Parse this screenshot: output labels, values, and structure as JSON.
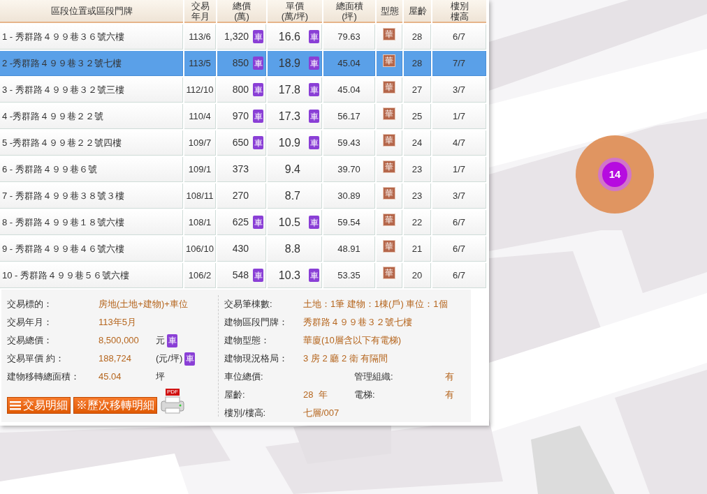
{
  "table": {
    "columns": [
      [
        "區段位置或區段門牌"
      ],
      [
        "交易",
        "年月"
      ],
      [
        "總價",
        "(萬)"
      ],
      [
        "單價",
        "(萬/坪)"
      ],
      [
        "總面積",
        "(坪)"
      ],
      [
        "型態"
      ],
      [
        "屋齡"
      ],
      [
        "樓別",
        "樓高"
      ]
    ],
    "rows": [
      {
        "address": "1 - 秀群路４９９巷３６號六樓",
        "date": "113/6",
        "total": "1,320",
        "total_badge": "車",
        "unit": "16.6",
        "unit_badge": "車",
        "area": "79.63",
        "type": "華",
        "age": "28",
        "floor": "6/7",
        "selected": false
      },
      {
        "address": "2 -秀群路４９９巷３２號七樓",
        "date": "113/5",
        "total": "850",
        "total_badge": "車",
        "unit": "18.9",
        "unit_badge": "車",
        "area": "45.04",
        "type": "華",
        "age": "28",
        "floor": "7/7",
        "selected": true
      },
      {
        "address": "3 - 秀群路４９９巷３２號三樓",
        "date": "112/10",
        "total": "800",
        "total_badge": "車",
        "unit": "17.8",
        "unit_badge": "車",
        "area": "45.04",
        "type": "華",
        "age": "27",
        "floor": "3/7",
        "selected": false
      },
      {
        "address": "4 -秀群路４９９巷２２號",
        "date": "110/4",
        "total": "970",
        "total_badge": "車",
        "unit": "17.3",
        "unit_badge": "車",
        "area": "56.17",
        "type": "華",
        "age": "25",
        "floor": "1/7",
        "selected": false
      },
      {
        "address": "5 -秀群路４９９巷２２號四樓",
        "date": "109/7",
        "total": "650",
        "total_badge": "車",
        "unit": "10.9",
        "unit_badge": "車",
        "area": "59.43",
        "type": "華",
        "age": "24",
        "floor": "4/7",
        "selected": false
      },
      {
        "address": "6 - 秀群路４９９巷６號",
        "date": "109/1",
        "total": "373",
        "unit": "9.4",
        "area": "39.70",
        "type": "華",
        "age": "23",
        "floor": "1/7",
        "selected": false
      },
      {
        "address": "7 - 秀群路４９９巷３８號３樓",
        "date": "108/11",
        "total": "270",
        "unit": "8.7",
        "area": "30.89",
        "type": "華",
        "age": "23",
        "floor": "3/7",
        "selected": false
      },
      {
        "address": "8 - 秀群路４９９巷１８號六樓",
        "date": "108/1",
        "total": "625",
        "total_badge": "車",
        "unit": "10.5",
        "unit_badge": "車",
        "area": "59.54",
        "type": "華",
        "age": "22",
        "floor": "6/7",
        "selected": false
      },
      {
        "address": "9 - 秀群路４９９巷４６號六樓",
        "date": "106/10",
        "total": "430",
        "unit": "8.8",
        "area": "48.91",
        "type": "華",
        "age": "21",
        "floor": "6/7",
        "selected": false
      },
      {
        "address": "10 - 秀群路４９９巷５６號六樓",
        "date": "106/2",
        "total": "548",
        "total_badge": "車",
        "unit": "10.3",
        "unit_badge": "車",
        "area": "53.35",
        "type": "華",
        "age": "20",
        "floor": "6/7",
        "selected": false
      }
    ]
  },
  "details_left": [
    {
      "label": "交易標的：",
      "value": "房地(土地+建物)+車位"
    },
    {
      "label": "交易年月：",
      "value": "113年5月"
    },
    {
      "label": "交易總價：",
      "value": "8,500,000",
      "unit": "元",
      "badge": "車"
    },
    {
      "label": "交易單價 約：",
      "value": "188,724",
      "unit": "(元/坪)",
      "badge": "車"
    },
    {
      "label": "建物移轉總面積：",
      "value": "45.04",
      "unit": "坪"
    }
  ],
  "details_right": [
    {
      "label": "交易筆棟數:",
      "value": "土地：1筆 建物：1棟(戶) 車位：1個"
    },
    {
      "label": "建物區段門牌：",
      "value": "秀群路４９９巷３２號七樓"
    },
    {
      "label": "建物型態：",
      "value": "華廈(10層含以下有電梯)"
    },
    {
      "label": "建物現況格局：",
      "value": "3 房 2 廳 2 衛 有隔間"
    }
  ],
  "details_grid": [
    {
      "label": "車位總價:",
      "extra_label": "管理組織:",
      "extra_value": "有"
    },
    {
      "label": "屋齡:",
      "value": "28  年",
      "extra_label": "電梯:",
      "extra_value": "有"
    },
    {
      "label": "樓別/樓高:",
      "value": "七層/007"
    }
  ],
  "buttons": [
    {
      "label": "交易明細",
      "kind": "menu"
    },
    {
      "label": "※歷次移轉明細",
      "kind": "plain"
    }
  ],
  "print_button": {
    "label": "PDF"
  },
  "map": {
    "kind": "picture",
    "marker": {
      "count": "14"
    }
  }
}
